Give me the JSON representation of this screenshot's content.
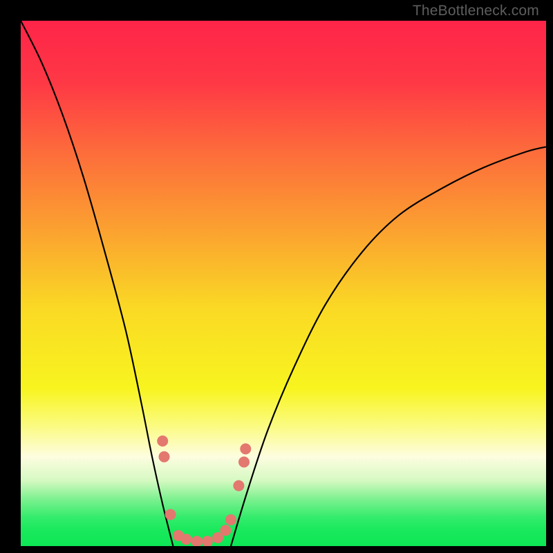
{
  "watermark": "TheBottleneck.com",
  "chart_data": {
    "type": "line",
    "title": "",
    "xlabel": "",
    "ylabel": "",
    "xlim": [
      0,
      100
    ],
    "ylim": [
      0,
      100
    ],
    "gradient_stops": [
      {
        "offset": 0,
        "color": "#fe2449"
      },
      {
        "offset": 0.12,
        "color": "#fe3945"
      },
      {
        "offset": 0.25,
        "color": "#fd6c3b"
      },
      {
        "offset": 0.4,
        "color": "#fba230"
      },
      {
        "offset": 0.55,
        "color": "#fada24"
      },
      {
        "offset": 0.7,
        "color": "#f8f41f"
      },
      {
        "offset": 0.77,
        "color": "#fbfb80"
      },
      {
        "offset": 0.83,
        "color": "#fdfde0"
      },
      {
        "offset": 0.875,
        "color": "#d6f9c2"
      },
      {
        "offset": 0.91,
        "color": "#7ef190"
      },
      {
        "offset": 0.945,
        "color": "#34ec6c"
      },
      {
        "offset": 0.97,
        "color": "#19e95c"
      },
      {
        "offset": 1.0,
        "color": "#0de755"
      }
    ],
    "series": [
      {
        "name": "curve-left",
        "x": [
          0,
          4,
          8,
          12,
          16,
          20,
          23,
          25,
          27,
          29
        ],
        "y": [
          100,
          92,
          82,
          70,
          56,
          41,
          27,
          17,
          8,
          0
        ]
      },
      {
        "name": "curve-right",
        "x": [
          40,
          43,
          47,
          52,
          58,
          65,
          72,
          80,
          88,
          96,
          100
        ],
        "y": [
          0,
          10,
          22,
          34,
          46,
          56,
          63,
          68,
          72,
          75,
          76
        ]
      }
    ],
    "markers": {
      "name": "data-points",
      "color": "#e3786f",
      "points": [
        {
          "x": 27.0,
          "y": 20.0
        },
        {
          "x": 27.3,
          "y": 17.0
        },
        {
          "x": 28.5,
          "y": 6.0
        },
        {
          "x": 30.0,
          "y": 2.0
        },
        {
          "x": 31.5,
          "y": 1.3
        },
        {
          "x": 33.5,
          "y": 0.9
        },
        {
          "x": 35.5,
          "y": 0.9
        },
        {
          "x": 37.5,
          "y": 1.6
        },
        {
          "x": 39.0,
          "y": 3.0
        },
        {
          "x": 40.0,
          "y": 5.0
        },
        {
          "x": 41.5,
          "y": 11.5
        },
        {
          "x": 42.5,
          "y": 16.0
        },
        {
          "x": 42.8,
          "y": 18.5
        }
      ],
      "radius": 8
    }
  }
}
